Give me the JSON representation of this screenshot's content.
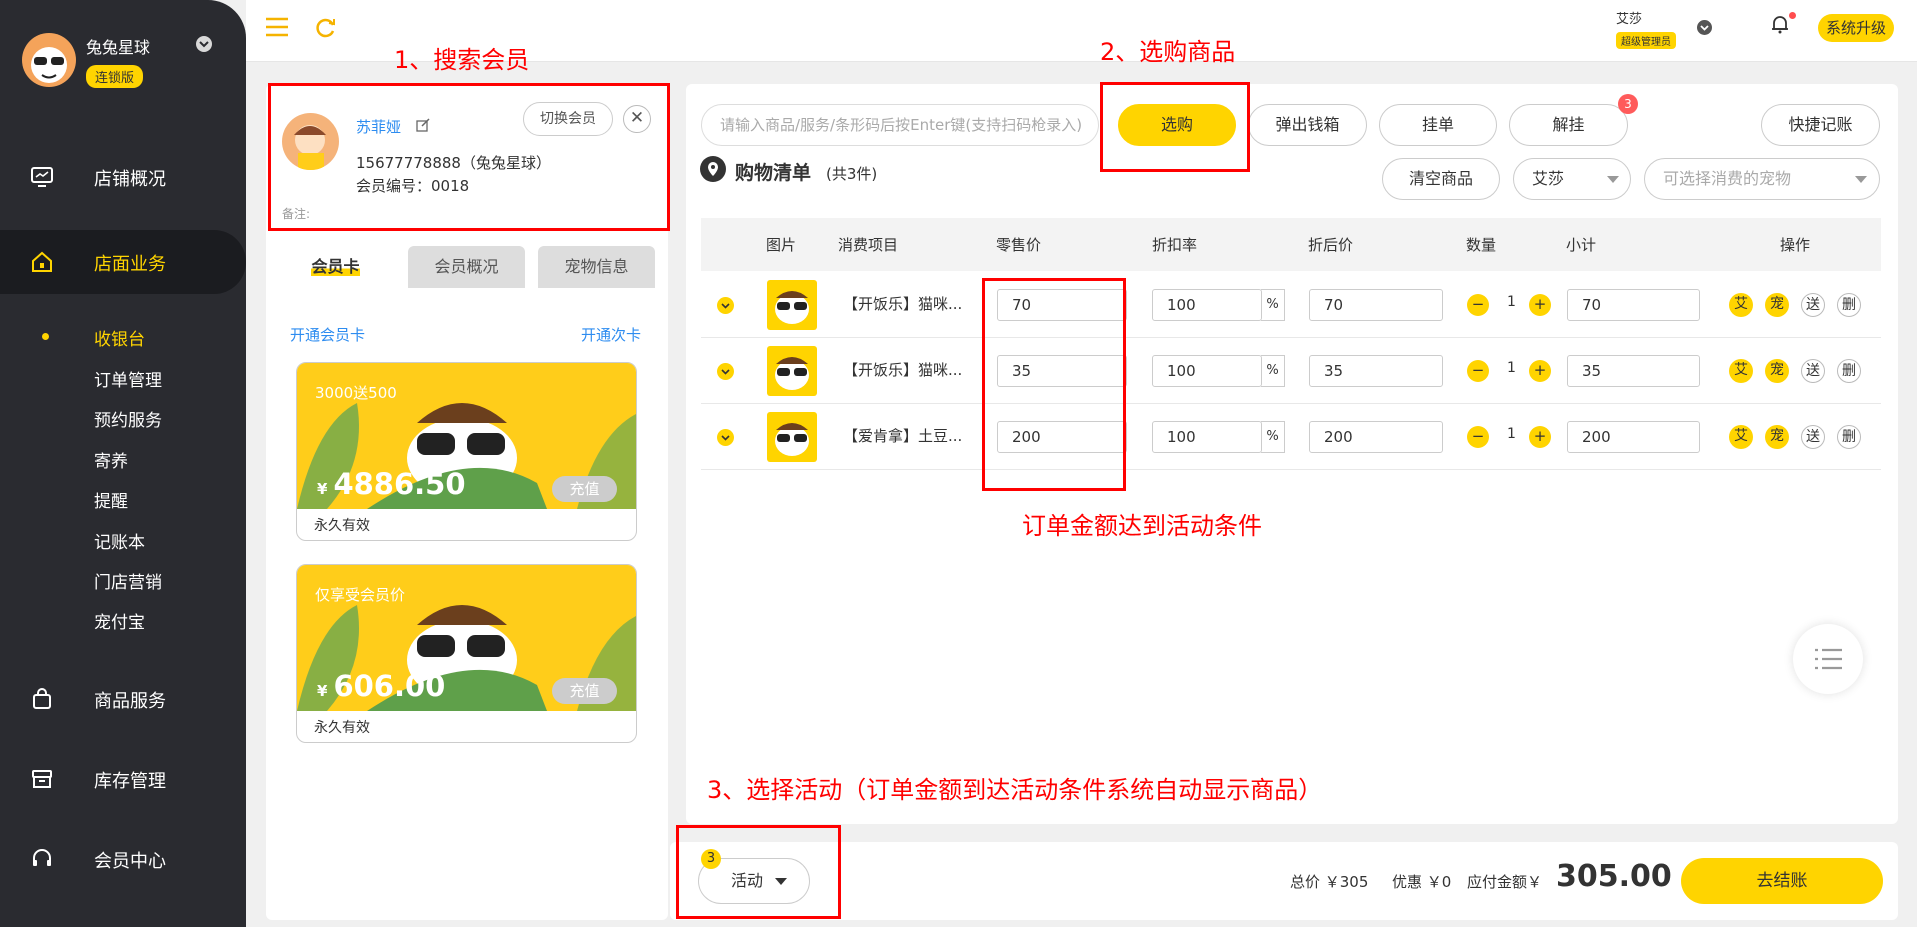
{
  "sidebar": {
    "store_name": "兔兔星球",
    "edition_badge": "连锁版",
    "nav": [
      {
        "label": "店铺概况",
        "icon": "monitor-icon"
      },
      {
        "label": "店面业务",
        "icon": "home-icon"
      },
      {
        "label": "商品服务",
        "icon": "bag-icon"
      },
      {
        "label": "库存管理",
        "icon": "box-icon"
      },
      {
        "label": "会员中心",
        "icon": "headset-icon"
      }
    ],
    "sub_nav": [
      "收银台",
      "订单管理",
      "预约服务",
      "寄养",
      "提醒",
      "记账本",
      "门店营销",
      "宠付宝"
    ],
    "active_sub": "收银台",
    "accent_color": "#ffd400"
  },
  "topbar": {
    "user_name": "艾莎",
    "user_role": "超级管理员",
    "upgrade_label": "系统升级"
  },
  "member": {
    "name": "苏菲娅",
    "switch_label": "切换会员",
    "close_label": "✕",
    "phone_line": "15677778888（兔兔星球）",
    "member_no_line": "会员编号：0018",
    "note_label": "备注:",
    "tabs": [
      "会员卡",
      "会员概况",
      "宠物信息"
    ],
    "open_card_link": "开通会员卡",
    "open_times_link": "开通次卡",
    "cards": [
      {
        "title": "3000送500",
        "currency": "¥",
        "amount": "4886.50",
        "recharge": "充值",
        "validity": "永久有效"
      },
      {
        "title": "仅享受会员价",
        "currency": "¥",
        "amount": "606.00",
        "recharge": "充值",
        "validity": "永久有效"
      }
    ]
  },
  "toolbar": {
    "search_placeholder": "请输入商品/服务/条形码后按Enter键(支持扫码枪录入)",
    "select_btn": "选购",
    "cash_drawer_btn": "弹出钱箱",
    "hang_btn": "挂单",
    "unhang_btn": "解挂",
    "unhang_badge": "3",
    "quick_note_btn": "快捷记账",
    "clear_btn": "清空商品",
    "staff_select": "艾莎",
    "pet_placeholder": "可选择消费的宠物"
  },
  "cart": {
    "title": "购物清单",
    "count": "(共3件)",
    "columns": [
      "图片",
      "消费项目",
      "零售价",
      "折扣率",
      "折后价",
      "数量",
      "小计",
      "操作"
    ],
    "rows": [
      {
        "name": "【开饭乐】猫咪...",
        "price": "70",
        "discount": "100",
        "pct": "%",
        "discounted": "70",
        "qty": "1",
        "subtotal": "70"
      },
      {
        "name": "【开饭乐】猫咪...",
        "price": "35",
        "discount": "100",
        "pct": "%",
        "discounted": "35",
        "qty": "1",
        "subtotal": "35"
      },
      {
        "name": "【爱肯拿】土豆...",
        "price": "200",
        "discount": "100",
        "pct": "%",
        "discounted": "200",
        "qty": "1",
        "subtotal": "200"
      }
    ],
    "ops": [
      "艾",
      "宠",
      "送",
      "删"
    ]
  },
  "footer": {
    "activity_label": "活动",
    "activity_badge": "3",
    "total_label": "总价 ￥305",
    "discount_label": "优惠 ￥0",
    "payable_label": "应付金额￥",
    "payable_amount": "305.00",
    "checkout_label": "去结账"
  },
  "annotations": {
    "step1": "1、搜索会员",
    "step2": "2、选购商品",
    "order_condition": "订单金额达到活动条件",
    "step3": "3、选择活动（订单金额到达活动条件系统自动显示商品）"
  }
}
